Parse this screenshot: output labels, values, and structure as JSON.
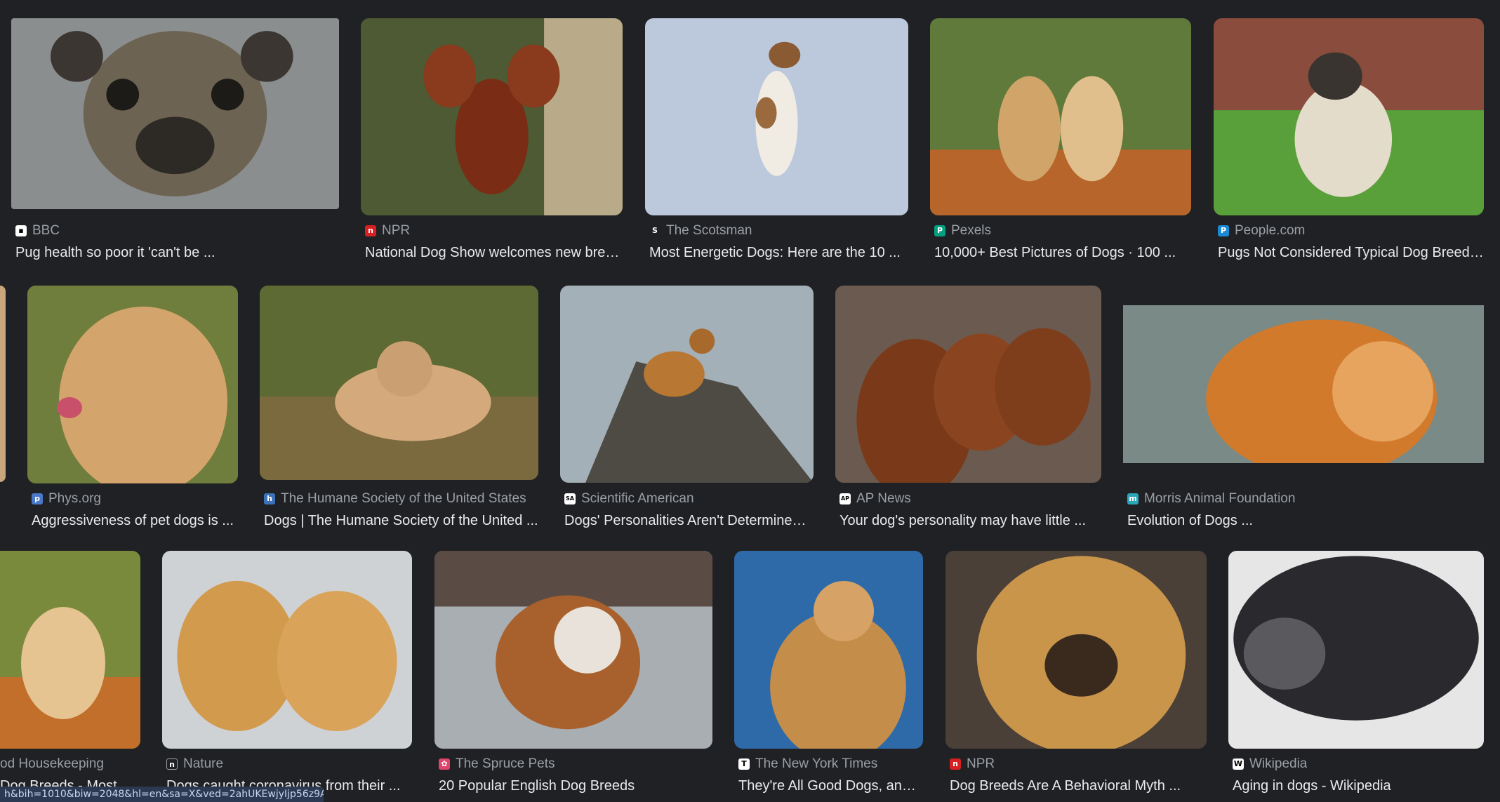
{
  "results": [
    {
      "source": "BBC",
      "title": "Pug health so poor it 'can't be ...",
      "favicon": "bbc-icon",
      "fav_color": "#ffffff",
      "fav_text": "▪▪"
    },
    {
      "source": "NPR",
      "title": "National Dog Show welcomes new bree...",
      "favicon": "npr-icon",
      "fav_color": "#d62021",
      "fav_text": "n"
    },
    {
      "source": "The Scotsman",
      "title": "Most Energetic Dogs: Here are the 10 ...",
      "favicon": "scotsman-icon",
      "fav_color": "#202124",
      "fav_text": "S"
    },
    {
      "source": "Pexels",
      "title": "10,000+ Best Pictures of Dogs · 100 ...",
      "favicon": "pexels-icon",
      "fav_color": "#05a081",
      "fav_text": "P"
    },
    {
      "source": "People.com",
      "title": "Pugs Not Considered Typical Dog Breed ...",
      "favicon": "people-icon",
      "fav_color": "#1a8ad6",
      "fav_text": "P"
    },
    {
      "source": "Phys.org",
      "title": "Aggressiveness of pet dogs is ...",
      "favicon": "physorg-icon",
      "fav_color": "#4a78c8",
      "fav_text": "p"
    },
    {
      "source": "The Humane Society of the United States",
      "title": "Dogs | The Humane Society of the United ...",
      "favicon": "humane-society-icon",
      "fav_color": "#3b72b9",
      "fav_text": "h"
    },
    {
      "source": "Scientific American",
      "title": "Dogs' Personalities Aren't Determined ...",
      "favicon": "scientific-american-icon",
      "fav_color": "#ffffff",
      "fav_text": "SA"
    },
    {
      "source": "AP News",
      "title": "Your dog's personality may have little ...",
      "favicon": "ap-news-icon",
      "fav_color": "#ffffff",
      "fav_text": "AP"
    },
    {
      "source": "Morris Animal Foundation",
      "title": "Evolution of Dogs ...",
      "favicon": "morris-icon",
      "fav_color": "#2aa6b8",
      "fav_text": "m"
    },
    {
      "source": "od Housekeeping",
      "title": "Dog Breeds - Most A...",
      "favicon": "housekeeping-icon",
      "fav_color": "#c0392b",
      "fav_text": "g"
    },
    {
      "source": "Nature",
      "title": "Dogs caught coronavirus from their ...",
      "favicon": "nature-icon",
      "fav_color": "#202124",
      "fav_text": "n"
    },
    {
      "source": "The Spruce Pets",
      "title": "20 Popular English Dog Breeds",
      "favicon": "spruce-pets-icon",
      "fav_color": "#e0436b",
      "fav_text": "✿"
    },
    {
      "source": "The New York Times",
      "title": "They're All Good Dogs, and I...",
      "favicon": "nyt-icon",
      "fav_color": "#ffffff",
      "fav_text": "T"
    },
    {
      "source": "NPR",
      "title": "Dog Breeds Are A Behavioral Myth ...",
      "favicon": "npr-icon",
      "fav_color": "#d62021",
      "fav_text": "n"
    },
    {
      "source": "Wikipedia",
      "title": "Aging in dogs - Wikipedia",
      "favicon": "wikipedia-icon",
      "fav_color": "#ffffff",
      "fav_text": "W"
    }
  ],
  "status_url": "h&bih=1010&biw=2048&hl=en&sa=X&ved=2ahUKEwjyIjp56z9A"
}
